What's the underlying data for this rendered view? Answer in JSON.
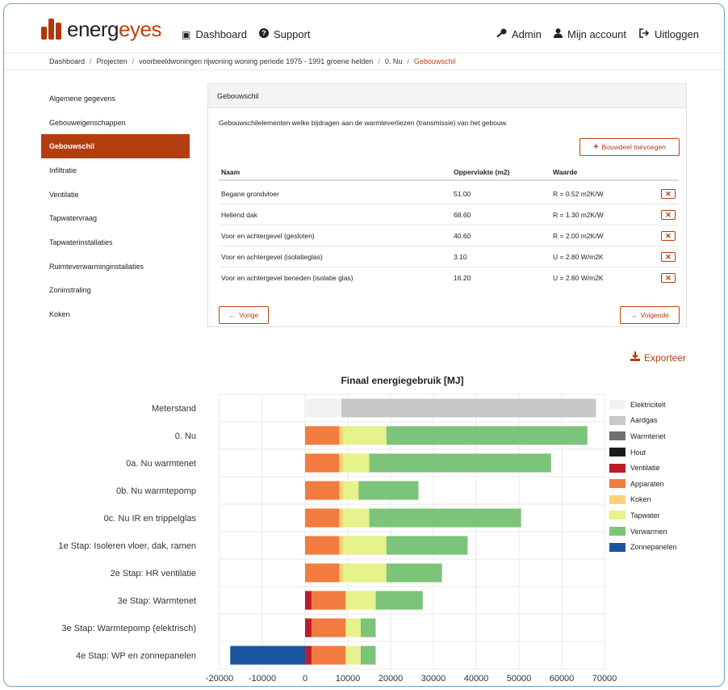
{
  "app": {
    "logo_part1": "energ",
    "logo_part2": "eyes"
  },
  "nav": {
    "dashboard": "Dashboard",
    "support": "Support",
    "admin": "Admin",
    "account": "Mijn account",
    "logout": "Uitloggen"
  },
  "breadcrumb": [
    "Dashboard",
    "Projecten",
    "voorbeeldwoningen rijwoning woning periode 1975 - 1991 groene helden",
    "0. Nu",
    "Gebouwschil"
  ],
  "sidebar": {
    "items": [
      {
        "label": "Algemene gegevens"
      },
      {
        "label": "Gebouweigenschappen"
      },
      {
        "label": "Gebouwschil",
        "active": true
      },
      {
        "label": "Infiltratie"
      },
      {
        "label": "Ventilatie"
      },
      {
        "label": "Tapwatervraag"
      },
      {
        "label": "Tapwaterinstallaties"
      },
      {
        "label": "Ruimteverwarminginstallaties"
      },
      {
        "label": "Zoninstraling"
      },
      {
        "label": "Koken"
      }
    ]
  },
  "panel": {
    "title": "Gebouwschil",
    "description": "Gebouwschilelementen welke bijdragen aan de warmteverliezen (transmissie) van het gebouw.",
    "add_button": "Bouwdeel toevoegen",
    "columns": [
      "Naam",
      "Oppervlakte (m2)",
      "Waarde"
    ],
    "rows": [
      {
        "name": "Begane grondvloer",
        "area": "51.00",
        "value": "R = 0.52 m2K/W"
      },
      {
        "name": "Hellend dak",
        "area": "68.60",
        "value": "R = 1.30 m2K/W"
      },
      {
        "name": "Voor en achtergevel (gesloten)",
        "area": "40.60",
        "value": "R = 2.00 m2K/W"
      },
      {
        "name": "Voor en achtergevel (isolatieglas)",
        "area": "3.10",
        "value": "U = 2.80 W/m2K"
      },
      {
        "name": "Voor en achtergevel beneden (isolatie glas)",
        "area": "16.20",
        "value": "U = 2.80 W/m2K"
      }
    ],
    "prev_button": "Vorige",
    "next_button": "Volgende"
  },
  "export_label": "Exporteer",
  "chart_data": {
    "type": "bar",
    "orientation": "horizontal",
    "stacked": true,
    "title": "Finaal energiegebruik [MJ]",
    "xlim": [
      -20000,
      70000
    ],
    "xticks": [
      -20000,
      -10000,
      0,
      10000,
      20000,
      30000,
      40000,
      50000,
      60000,
      70000
    ],
    "grid": true,
    "legend_position": "right",
    "categories": [
      "Meterstand",
      "0. Nu",
      "0a. Nu warmtenet",
      "0b. Nu warmtepomp",
      "0c. Nu IR en  trippelglas",
      "1e Stap: Isoleren  vloer, dak, ramen",
      "2e Stap: HR  ventilatie",
      "3e Stap: Warmtenet",
      "3e Stap: Warmtepomp  (elektrisch)",
      "4e Stap: WP en  zonnepanelen"
    ],
    "series": [
      {
        "name": "Elektriciteit",
        "color": "#f2f2f2",
        "values": [
          8500,
          0,
          0,
          0,
          0,
          0,
          0,
          0,
          0,
          0
        ]
      },
      {
        "name": "Aardgas",
        "color": "#c8c8c8",
        "values": [
          59500,
          0,
          0,
          0,
          0,
          0,
          0,
          0,
          0,
          0
        ]
      },
      {
        "name": "Warmtenet",
        "color": "#707070",
        "values": [
          0,
          0,
          0,
          0,
          0,
          0,
          0,
          0,
          0,
          0
        ]
      },
      {
        "name": "Hout",
        "color": "#1b1b1b",
        "values": [
          0,
          0,
          0,
          0,
          0,
          0,
          0,
          0,
          0,
          0
        ]
      },
      {
        "name": "Ventilatie",
        "color": "#b91c2c",
        "values": [
          0,
          0,
          0,
          0,
          0,
          0,
          0,
          1500,
          1500,
          1500
        ]
      },
      {
        "name": "Apparaten",
        "color": "#f27b40",
        "values": [
          0,
          8000,
          8000,
          8000,
          8000,
          8000,
          8000,
          8000,
          8000,
          8000
        ]
      },
      {
        "name": "Koken",
        "color": "#f9d27a",
        "values": [
          0,
          1000,
          1000,
          1000,
          1000,
          1000,
          1000,
          0,
          0,
          0
        ]
      },
      {
        "name": "Tapwater",
        "color": "#e6f28c",
        "values": [
          0,
          10000,
          6000,
          3500,
          6000,
          10000,
          10000,
          7000,
          3500,
          3500
        ]
      },
      {
        "name": "Verwarmen",
        "color": "#7cc47a",
        "values": [
          0,
          47000,
          42500,
          14000,
          35500,
          19000,
          13000,
          11000,
          3500,
          3500
        ]
      },
      {
        "name": "Zonnepanelen",
        "color": "#1a56a0",
        "values": [
          0,
          0,
          0,
          0,
          0,
          0,
          0,
          0,
          0,
          -17500
        ]
      }
    ]
  }
}
